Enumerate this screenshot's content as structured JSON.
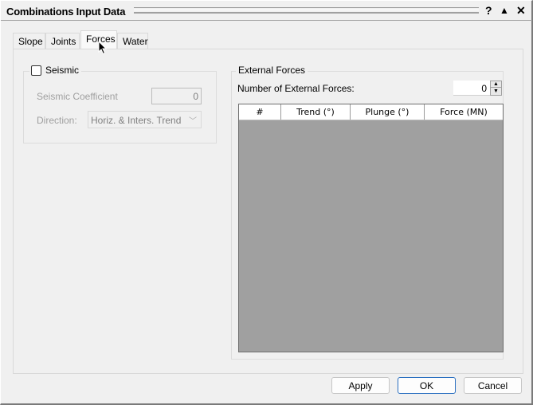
{
  "window": {
    "title": "Combinations Input Data",
    "controls": {
      "help": "?",
      "rollup": "▲",
      "close": "✕"
    }
  },
  "tabs": [
    {
      "label": "Slope",
      "active": false
    },
    {
      "label": "Joints",
      "active": false
    },
    {
      "label": "Forces",
      "active": true
    },
    {
      "label": "Water",
      "active": false
    }
  ],
  "seismic": {
    "checkbox_label": "Seismic",
    "checked": false,
    "coefficient_label": "Seismic Coefficient",
    "coefficient_value": "0",
    "direction_label": "Direction:",
    "direction_value": "Horiz. & Inters. Trend",
    "chevron": "﹀"
  },
  "external_forces": {
    "group_label": "External Forces",
    "number_label": "Number of External Forces:",
    "number_value": "0",
    "spin_up": "▲",
    "spin_down": "▼",
    "columns": [
      "#",
      "Trend (°)",
      "Plunge (°)",
      "Force (MN)"
    ],
    "rows": []
  },
  "buttons": {
    "apply": "Apply",
    "ok": "OK",
    "cancel": "Cancel"
  }
}
